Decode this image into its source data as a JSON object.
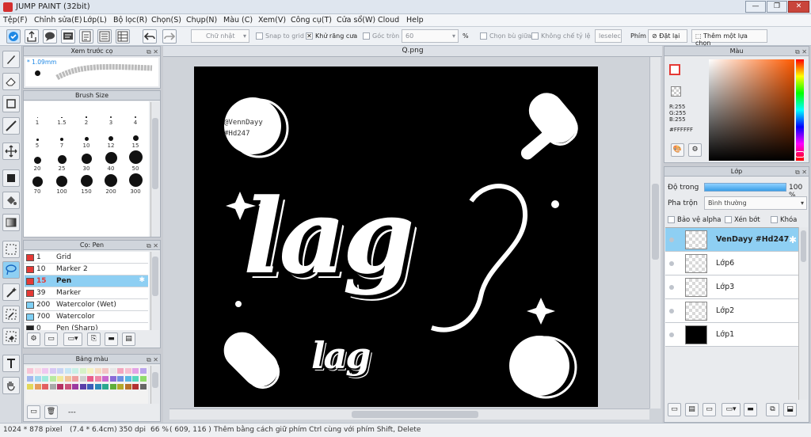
{
  "app": {
    "title": "JUMP PAINT (32bit)"
  },
  "menu": [
    "Tệp(F)",
    "Chỉnh sửa(E)",
    "Lớp(L)",
    "Bộ lọc(R)",
    "Chọn(S)",
    "Chụp(N)",
    "Màu (C)",
    "Xem(V)",
    "Công cụ(T)",
    "Cửa sổ(W)",
    "Cloud",
    "Help"
  ],
  "toolbar": {
    "shape_select": "Chữ nhật",
    "snap_label": "Snap to grid",
    "antialias_label": "Khử răng cưa",
    "corner_label": "Góc tròn",
    "corner_value": "60",
    "percent": "%",
    "select_center_label": "Chọn bù giữa",
    "no_ratio_label": "Không chế tỷ lệ",
    "deselect_label": "leselec",
    "key_label": "Phím",
    "reset_label": "Đặt lại",
    "add_selection_label": "Thêm một lựa chọn"
  },
  "brush_preview": {
    "title": "Xem trước cọ",
    "size_label": "* 1.09mm"
  },
  "brush_size": {
    "title": "Brush Size",
    "sizes": [
      "1",
      "1.5",
      "2",
      "3",
      "4",
      "5",
      "7",
      "10",
      "12",
      "15",
      "20",
      "25",
      "30",
      "40",
      "50",
      "70",
      "100",
      "150",
      "200",
      "300"
    ]
  },
  "brush_list": {
    "title": "Cọ: Pen",
    "items": [
      {
        "num": "1",
        "name": "Grid",
        "color": "#e53935"
      },
      {
        "num": "10",
        "name": "Marker 2",
        "color": "#e53935"
      },
      {
        "num": "15",
        "name": "Pen",
        "color": "#e53935",
        "selected": true
      },
      {
        "num": "39",
        "name": "Marker",
        "color": "#e53935"
      },
      {
        "num": "200",
        "name": "Watercolor (Wet)",
        "color": "#7fd0f5"
      },
      {
        "num": "700",
        "name": "Watercolor",
        "color": "#7fd0f5"
      },
      {
        "num": "0",
        "name": "Pen (Sharp)",
        "color": "#222222"
      }
    ]
  },
  "palette": {
    "title": "Bảng màu",
    "footer": "---"
  },
  "document": {
    "tab": "Q.png",
    "handle": "@VennDayy",
    "tag": "#Hd247",
    "main_word": "lag",
    "small_word": "lag"
  },
  "color_panel": {
    "title": "Màu",
    "r": "R:255",
    "g": "G:255",
    "b": "B:255",
    "hex": "#FFFFFF"
  },
  "layers": {
    "title": "Lớp",
    "opacity_label": "Độ trong",
    "opacity_value": "100 %",
    "opacity": 1.0,
    "blend_label": "Pha trộn",
    "blend_value": "Bình thường",
    "protect_alpha": "Bảo vệ alpha",
    "clipping": "Xén bớt",
    "lock": "Khóa",
    "items": [
      {
        "name": "VenDayy #Hd247",
        "selected": true
      },
      {
        "name": "Lớp6"
      },
      {
        "name": "Lớp3"
      },
      {
        "name": "Lớp2"
      },
      {
        "name": "Lớp1",
        "black": true
      }
    ]
  },
  "status": {
    "size": "1024 * 878 pixel",
    "cm": "(7.4 * 6.4cm)",
    "dpi": "350 dpi",
    "zoom": "66 %",
    "coords": "( 609, 116 )",
    "hint": "Thêm bằng cách giữ phím Ctrl cùng với phím Shift, Delete"
  }
}
